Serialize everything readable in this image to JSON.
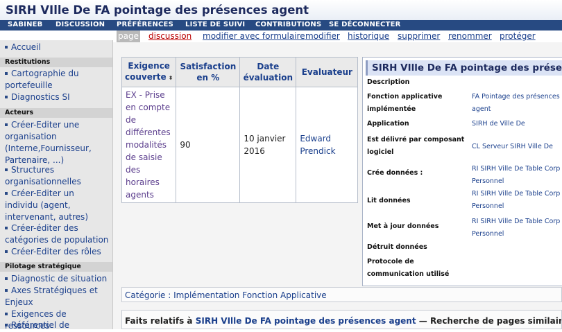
{
  "page": {
    "title": "SIRH VIlle De FA pointage des présences agent"
  },
  "usernav": [
    "SABINEB",
    "DISCUSSION",
    "PRÉFÉRENCES",
    "LISTE DE SUIVI",
    "CONTRIBUTIONS",
    "SE DÉCONNECTER"
  ],
  "actions": [
    "page",
    "discussion",
    "modifier avec formulaire",
    "modifier",
    "historique",
    "supprimer",
    "renommer",
    "protéger"
  ],
  "sidebar": {
    "top": [
      "Accueil"
    ],
    "sections": [
      {
        "title": "Restitutions",
        "items": [
          "Cartographie du portefeuille",
          "Diagnostics SI"
        ]
      },
      {
        "title": "Acteurs",
        "items": [
          "Créer-Editer une organisation (Interne,Fournisseur, Partenaire, ...)",
          "Structures organisationnelles",
          "Créer-Editer un individu (agent, intervenant, autres)",
          "Créer-éditer des catégories de population",
          "Créer-Editer des rôles"
        ]
      },
      {
        "title": "Pilotage stratégique",
        "items": [
          "Diagnostic de situation",
          "Axes Stratégiques et Enjeux",
          "Exigences de ressources",
          "Référentiel de"
        ]
      }
    ]
  },
  "table": {
    "headers": [
      "Exigence couverte",
      "Satisfaction en %",
      "Date évaluation",
      "Evaluateur"
    ],
    "sort_icon": "⬍",
    "row": {
      "exigence": "EX - Prise en compte de différentes modalités de saisie des horaires agents",
      "satisfaction": "90",
      "date": "10 janvier 2016",
      "evaluateur": "Edward Prendick"
    }
  },
  "infobox": {
    "title": "SIRH VIlle De FA pointage des présences agent",
    "rows": [
      {
        "label": "Description",
        "value": ""
      },
      {
        "label": "Fonction applicative implémentée",
        "value": "FA Pointage des présences agent"
      },
      {
        "label": "Application",
        "value": "SIRH de Ville De"
      },
      {
        "label": "Est délivré par composant logiciel",
        "value": "CL Serveur SIRH Ville De"
      },
      {
        "label": "Crée données :",
        "value": "RI SIRH Ville De Table Corp Personnel"
      },
      {
        "label": "Lit données",
        "value": "RI SIRH Ville De Table Corp Personnel"
      },
      {
        "label": "Met à jour données",
        "value": "RI SIRH Ville De Table Corp Personnel"
      },
      {
        "label": "Détruit données",
        "value": ""
      },
      {
        "label": "Protocole de communication utilisé",
        "value": ""
      }
    ]
  },
  "category": {
    "label": "Catégorie :",
    "value": "Implémentation Fonction Applicative"
  },
  "facts": {
    "prefix": "Faits relatifs à",
    "link": "SIRH VIlle De FA pointage des présences agent",
    "suffix": "— Recherche de pages similaires avec"
  },
  "colors": {
    "nav_bg": "#274a82",
    "link": "#1a3f8c",
    "sidebar_bg": "#e7e7e7",
    "infobox_title_bg": "#dbe3f5"
  }
}
